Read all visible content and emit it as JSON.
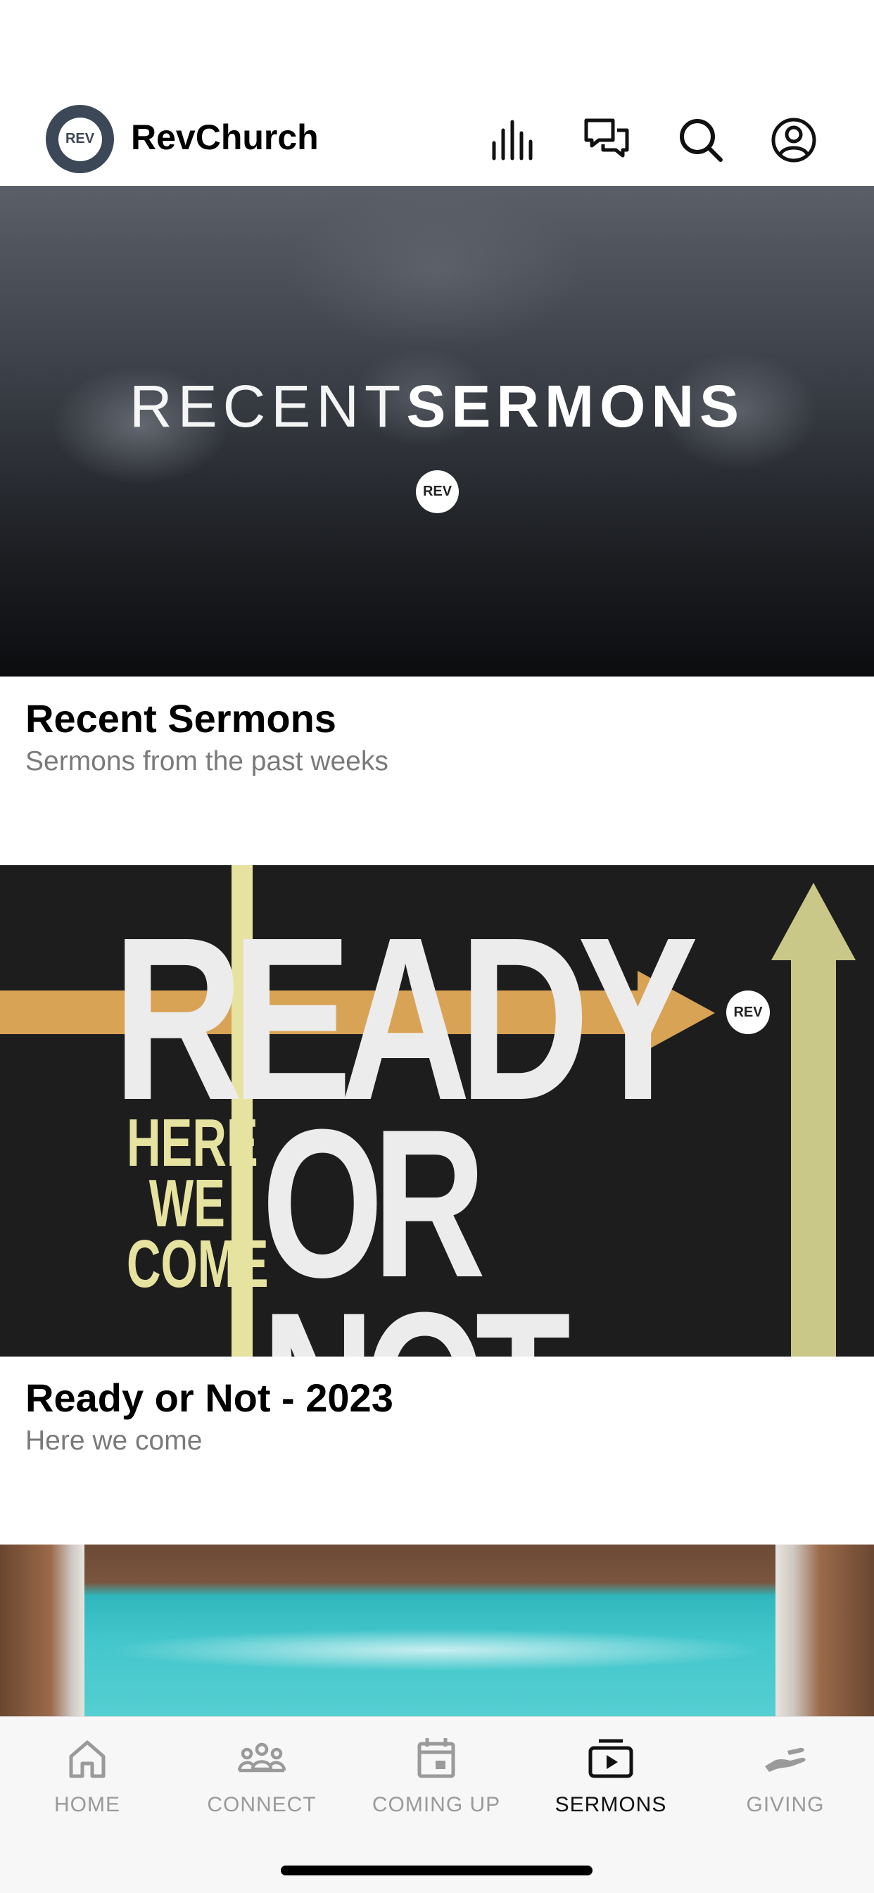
{
  "header": {
    "logo_text": "REV",
    "app_title": "RevChurch",
    "icons": [
      "audio-bars-icon",
      "chat-icon",
      "search-icon",
      "profile-icon"
    ]
  },
  "cards": [
    {
      "banner": {
        "title_thin": "RECENT",
        "title_bold": "SERMONS",
        "badge": "REV"
      },
      "title": "Recent Sermons",
      "subtitle": "Sermons from the past weeks"
    },
    {
      "banner": {
        "word1": "READY",
        "word2": "OR NOT",
        "side1": "HERE",
        "side2": "WE",
        "side3": "COME",
        "badge": "REV"
      },
      "title": "Ready or Not - 2023",
      "subtitle": "Here we come"
    }
  ],
  "tabs": [
    {
      "label": "HOME",
      "icon": "home-icon",
      "active": false
    },
    {
      "label": "CONNECT",
      "icon": "people-icon",
      "active": false
    },
    {
      "label": "COMING UP",
      "icon": "calendar-icon",
      "active": false
    },
    {
      "label": "SERMONS",
      "icon": "video-playlist-icon",
      "active": true
    },
    {
      "label": "GIVING",
      "icon": "giving-hand-icon",
      "active": false
    }
  ],
  "colors": {
    "logo_bg": "#3c4757",
    "active_tab": "#111111",
    "inactive_tab": "#9a9a9a",
    "subtitle": "#7a7a7a"
  }
}
